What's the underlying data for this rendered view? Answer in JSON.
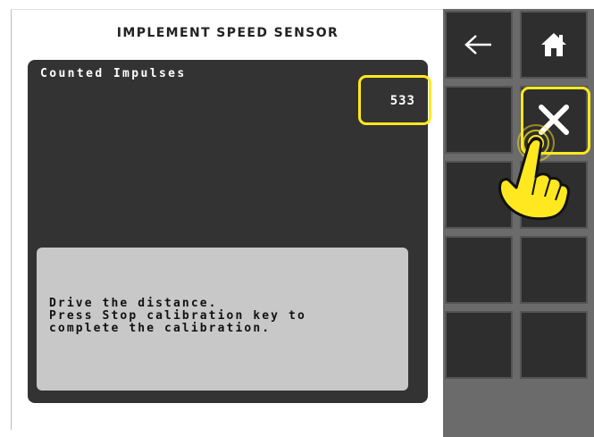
{
  "header": {
    "title": "IMPLEMENT SPEED SENSOR"
  },
  "counter": {
    "label": "Counted Impulses",
    "value": "533"
  },
  "message": {
    "lines": [
      "Drive the distance.",
      "Press Stop calibration key to",
      "complete the calibration."
    ]
  },
  "softkeys": [
    {
      "id": "back",
      "icon": "arrow-left-icon"
    },
    {
      "id": "home",
      "icon": "home-icon"
    },
    {
      "id": "empty-1",
      "icon": ""
    },
    {
      "id": "stop-calibration",
      "icon": "close-icon"
    },
    {
      "id": "empty-2",
      "icon": ""
    },
    {
      "id": "empty-3",
      "icon": ""
    },
    {
      "id": "empty-4",
      "icon": ""
    },
    {
      "id": "empty-5",
      "icon": ""
    },
    {
      "id": "empty-6",
      "icon": ""
    },
    {
      "id": "empty-7",
      "icon": ""
    }
  ],
  "colors": {
    "highlight": "#ffe81f",
    "panel_dark": "#333333",
    "message_bg": "#c8c8c8",
    "softkey_bg": "#2e2e2e",
    "softkey_column_bg": "#6b6b6b"
  }
}
